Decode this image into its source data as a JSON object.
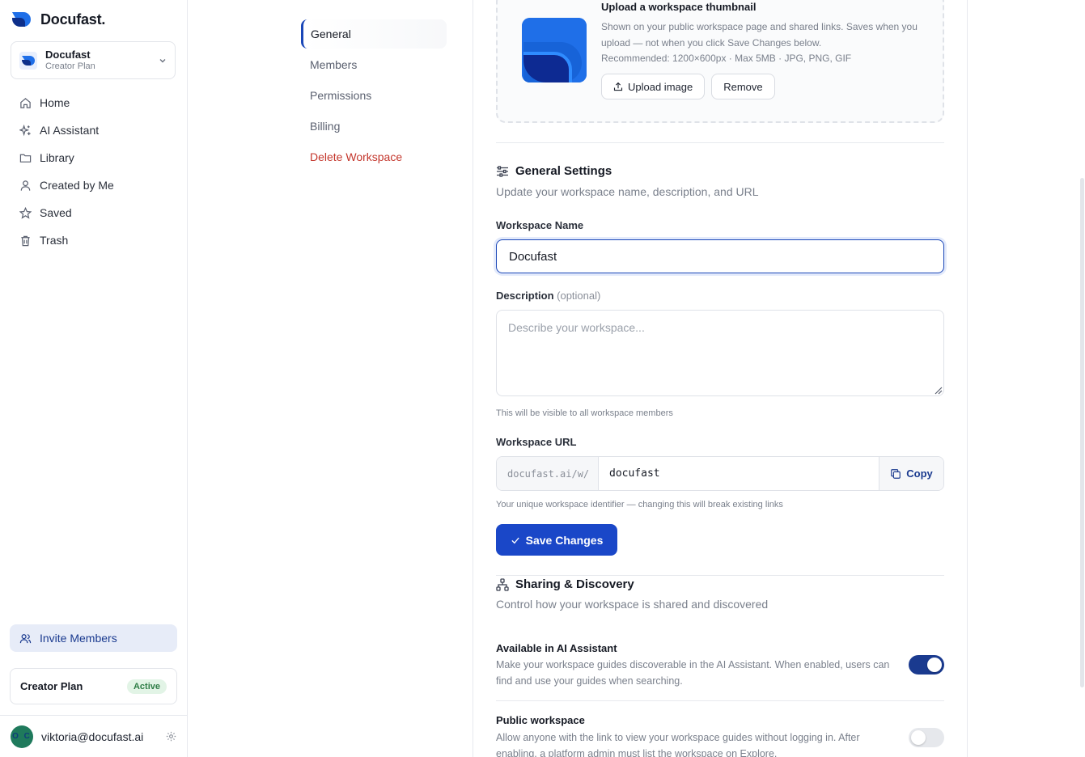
{
  "brand": {
    "name": "Docufast."
  },
  "workspace": {
    "name": "Docufast",
    "plan": "Creator Plan"
  },
  "nav": {
    "items": [
      {
        "label": "Home"
      },
      {
        "label": "AI Assistant"
      },
      {
        "label": "Library"
      },
      {
        "label": "Created by Me"
      },
      {
        "label": "Saved"
      },
      {
        "label": "Trash"
      }
    ],
    "invite_label": "Invite Members"
  },
  "plan_card": {
    "name": "Creator Plan",
    "status": "Active"
  },
  "user": {
    "initials": "O C",
    "email": "viktoria@docufast.ai"
  },
  "settings_nav": {
    "general": "General",
    "members": "Members",
    "permissions": "Permissions",
    "billing": "Billing",
    "delete": "Delete Workspace"
  },
  "thumbnail": {
    "title": "Upload a workspace thumbnail",
    "description": "Shown on your public workspace page and shared links. Saves when you upload — not when you click Save Changes below.",
    "recommendation": "Recommended: 1200×600px · Max 5MB · JPG, PNG, GIF",
    "upload_label": "Upload image",
    "remove_label": "Remove"
  },
  "general_settings": {
    "title": "General Settings",
    "subtitle": "Update your workspace name, description, and URL",
    "name_label": "Workspace Name",
    "name_value": "Docufast",
    "description_label": "Description",
    "description_optional": "(optional)",
    "description_placeholder": "Describe your workspace...",
    "description_hint": "This will be visible to all workspace members",
    "url_label": "Workspace URL",
    "url_prefix": "docufast.ai/w/",
    "url_value": "docufast",
    "copy_label": "Copy",
    "url_hint": "Your unique workspace identifier — changing this will break existing links",
    "save_label": "Save Changes"
  },
  "sharing": {
    "title": "Sharing & Discovery",
    "subtitle": "Control how your workspace is shared and discovered",
    "ai_title": "Available in AI Assistant",
    "ai_desc": "Make your workspace guides discoverable in the AI Assistant. When enabled, users can find and use your guides when searching.",
    "ai_enabled": true,
    "public_title": "Public workspace",
    "public_desc": "Allow anyone with the link to view your workspace guides without logging in. After enabling, a platform admin must list the workspace on Explore.",
    "public_enabled": false
  },
  "colors": {
    "accent": "#1a47c8",
    "accent_dark": "#1a3a8f",
    "danger": "#c4372d",
    "success": "#2e7d46"
  }
}
